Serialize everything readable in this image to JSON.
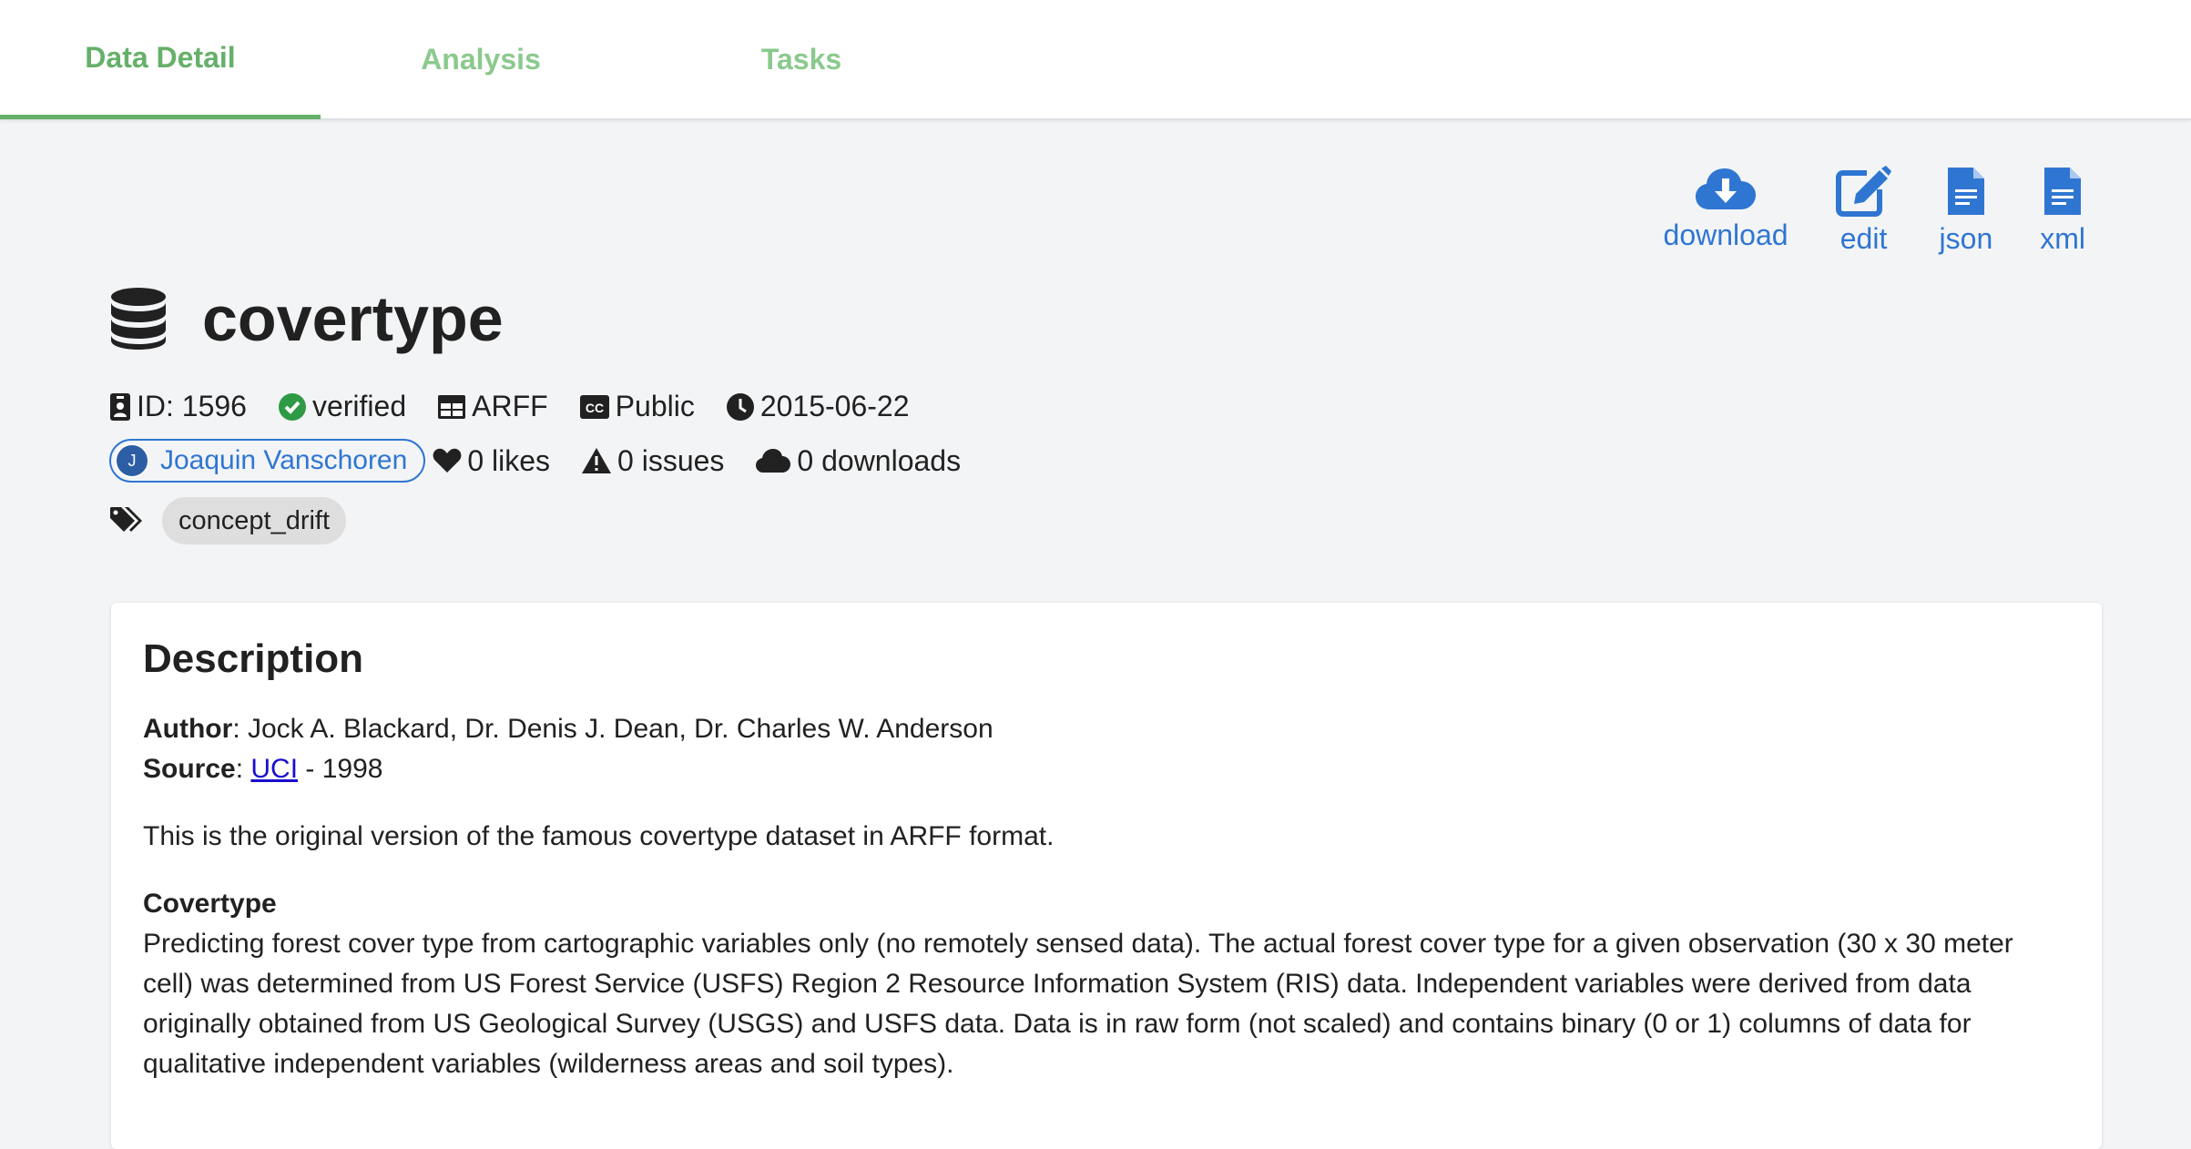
{
  "tabs": [
    {
      "label": "Data Detail",
      "active": true
    },
    {
      "label": "Analysis",
      "active": false
    },
    {
      "label": "Tasks",
      "active": false
    }
  ],
  "actions": {
    "download": "download",
    "edit": "edit",
    "json": "json",
    "xml": "xml"
  },
  "dataset": {
    "title": "covertype",
    "id": "ID: 1596",
    "status": "verified",
    "format": "ARFF",
    "license": "Public",
    "date": "2015-06-22",
    "user": "Joaquin Vanschoren",
    "user_initial": "J",
    "likes": "0 likes",
    "issues": "0 issues",
    "downloads": "0 downloads",
    "tags": [
      "concept_drift"
    ]
  },
  "description": {
    "heading": "Description",
    "author_label": "Author",
    "author_value": ": Jock A. Blackard, Dr. Denis J. Dean, Dr. Charles W. Anderson",
    "source_label": "Source",
    "source_sep": ": ",
    "source_link": "UCI",
    "source_rest": " - 1998",
    "intro": "This is the original version of the famous covertype dataset in ARFF format.",
    "subheading": "Covertype",
    "body": "Predicting forest cover type from cartographic variables only (no remotely sensed data). The actual forest cover type for a given observation (30 x 30 meter cell) was determined from US Forest Service (USFS) Region 2 Resource Information System (RIS) data. Independent variables were derived from data originally obtained from US Geological Survey (USGS) and USFS data. Data is in raw form (not scaled) and contains binary (0 or 1) columns of data for qualitative independent variables (wilderness areas and soil types)."
  },
  "colors": {
    "tab_active": "#66b06a",
    "tab_inactive": "#8bc98d",
    "link_blue": "#2f76d2",
    "verified_green": "#2e9a44"
  }
}
